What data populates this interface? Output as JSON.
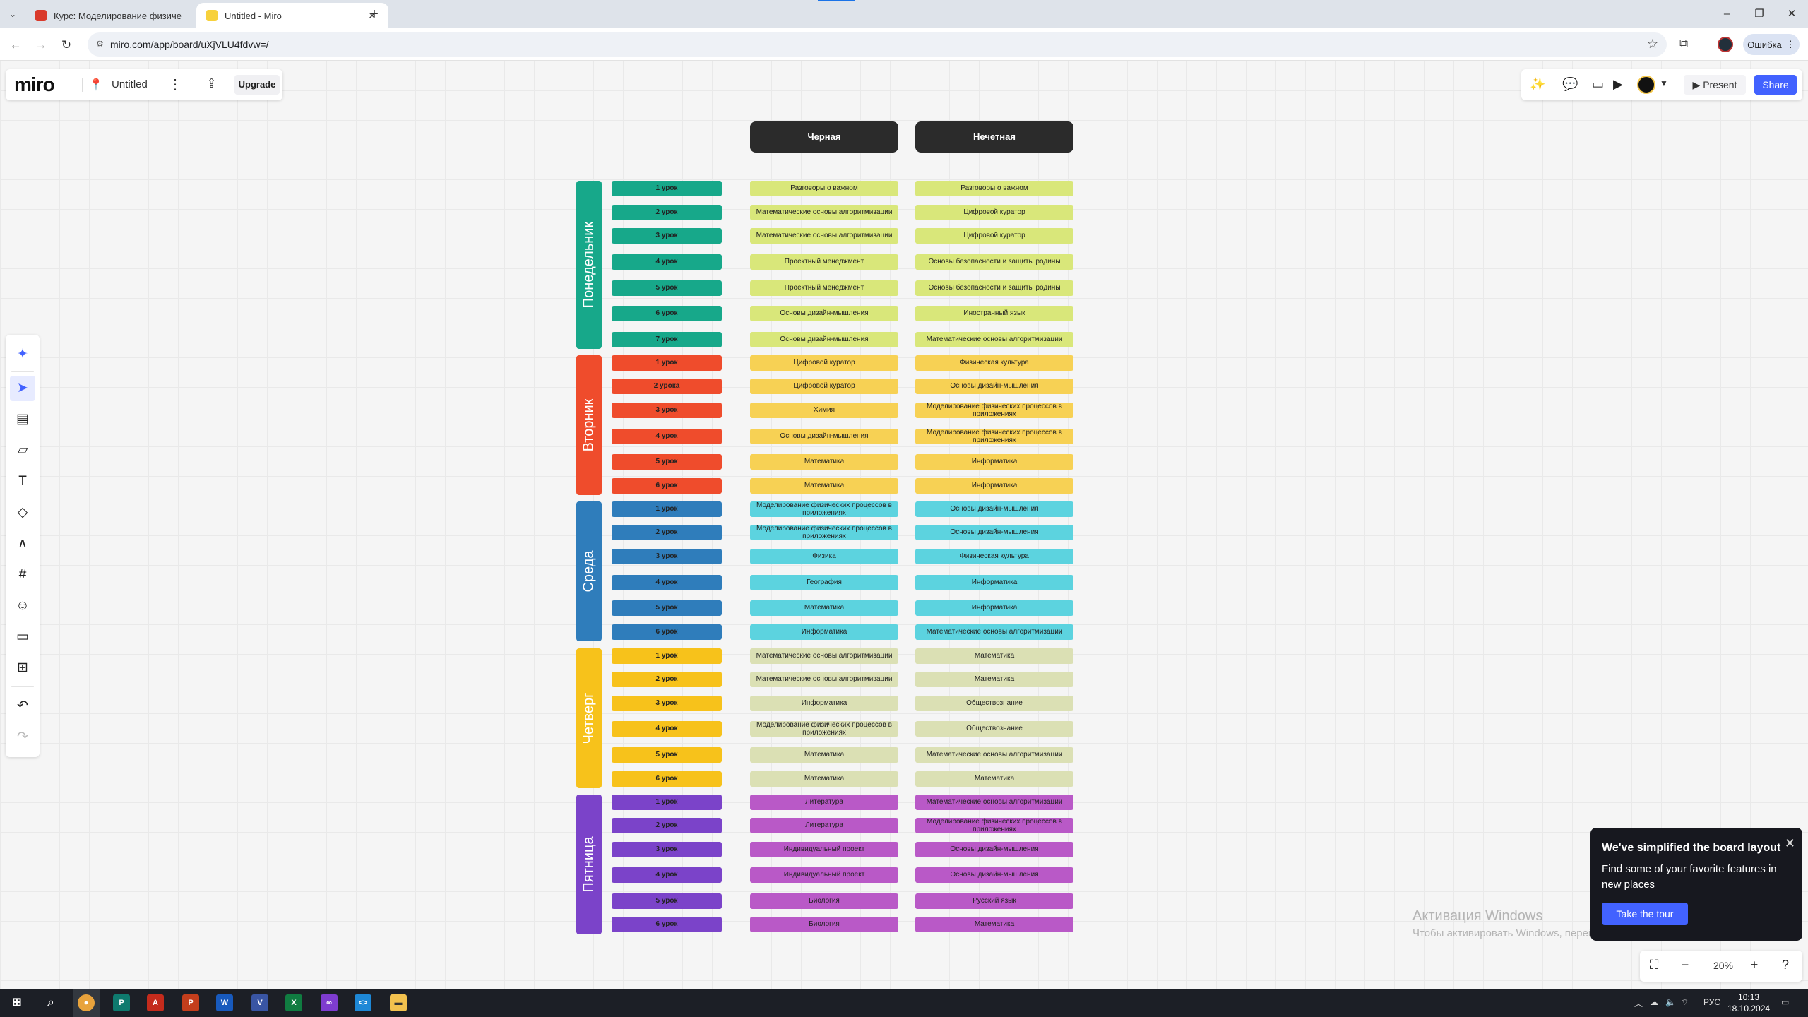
{
  "browser": {
    "tabs": [
      {
        "title": "Курс: Моделирование физиче",
        "active": false
      },
      {
        "title": "Untitled - Miro",
        "active": true
      }
    ],
    "url": "miro.com/app/board/uXjVLU4fdvw=/",
    "error_label": "Ошибка"
  },
  "miro": {
    "logo": "miro",
    "board_title": "Untitled",
    "upgrade_label": "Upgrade",
    "present_label": "Present",
    "share_label": "Share",
    "zoom": "20%",
    "accent_color": "#4262ff"
  },
  "schedule": {
    "headers": [
      "Черная",
      "Нечетная"
    ],
    "days": [
      {
        "name": "Понедельник",
        "color": "#17a88a",
        "lesson_color": "#17a88a",
        "cell_color": "#d9e77a",
        "lessons": [
          {
            "label": "1 урок",
            "a": "Разговоры о важном",
            "b": "Разговоры о важном"
          },
          {
            "label": "2 урок",
            "a": "Математические основы алгоритмизации",
            "b": "Цифровой куратор"
          },
          {
            "label": "3 урок",
            "a": "Математические основы алгоритмизации",
            "b": "Цифровой куратор"
          },
          {
            "label": "4 урок",
            "a": "Проектный менеджмент",
            "b": "Основы безопасности и защиты родины"
          },
          {
            "label": "5 урок",
            "a": "Проектный менеджмент",
            "b": "Основы безопасности и защиты родины"
          },
          {
            "label": "6 урок",
            "a": "Основы дизайн-мышления",
            "b": "Иностранный язык"
          },
          {
            "label": "7 урок",
            "a": "Основы дизайн-мышления",
            "b": "Математические основы алгоритмизации"
          }
        ]
      },
      {
        "name": "Вторник",
        "color": "#ef4c2c",
        "lesson_color": "#ef4c2c",
        "cell_color": "#f7d154",
        "lessons": [
          {
            "label": "1 урок",
            "a": "Цифровой куратор",
            "b": "Физическая культура"
          },
          {
            "label": "2 урока",
            "a": "Цифровой куратор",
            "b": "Основы дизайн-мышления"
          },
          {
            "label": "3 урок",
            "a": "Химия",
            "b": "Моделирование физических процессов в приложениях"
          },
          {
            "label": "4 урок",
            "a": "Основы дизайн-мышления",
            "b": "Моделирование физических процессов в приложениях"
          },
          {
            "label": "5 урок",
            "a": "Математика",
            "b": "Информатика"
          },
          {
            "label": "6 урок",
            "a": "Математика",
            "b": "Информатика"
          }
        ]
      },
      {
        "name": "Среда",
        "color": "#2f7dbb",
        "lesson_color": "#2f7dbb",
        "cell_color": "#5cd3df",
        "lessons": [
          {
            "label": "1 урок",
            "a": "Моделирование физических процессов в приложениях",
            "b": "Основы дизайн-мышления"
          },
          {
            "label": "2 урок",
            "a": "Моделирование физических процессов в приложениях",
            "b": "Основы дизайн-мышления"
          },
          {
            "label": "3 урок",
            "a": "Физика",
            "b": "Физическая культура"
          },
          {
            "label": "4 урок",
            "a": "География",
            "b": "Информатика"
          },
          {
            "label": "5 урок",
            "a": "Математика",
            "b": "Информатика"
          },
          {
            "label": "6 урок",
            "a": "Информатика",
            "b": "Математические основы алгоритмизации"
          }
        ]
      },
      {
        "name": "Четверг",
        "color": "#f7c21b",
        "lesson_color": "#f7c21b",
        "cell_color": "#dbe0b4",
        "lessons": [
          {
            "label": "1 урок",
            "a": "Математические основы алгоритмизации",
            "b": "Математика"
          },
          {
            "label": "2 урок",
            "a": "Математические основы алгоритмизации",
            "b": "Математика"
          },
          {
            "label": "3 урок",
            "a": "Информатика",
            "b": "Обществознание"
          },
          {
            "label": "4 урок",
            "a": "Моделирование физических процессов в приложениях",
            "b": "Обществознание"
          },
          {
            "label": "5 урок",
            "a": "Математика",
            "b": "Математические основы алгоритмизации"
          },
          {
            "label": "6 урок",
            "a": "Математика",
            "b": "Математика"
          }
        ]
      },
      {
        "name": "Пятница",
        "color": "#7b43c9",
        "lesson_color": "#7b43c9",
        "cell_color": "#b959c7",
        "lessons": [
          {
            "label": "1 урок",
            "a": "Литература",
            "b": "Математические основы алгоритмизации"
          },
          {
            "label": "2 урок",
            "a": "Литература",
            "b": "Моделирование физических процессов в приложениях"
          },
          {
            "label": "3 урок",
            "a": "Индивидуальный проект",
            "b": "Основы дизайн-мышления"
          },
          {
            "label": "4 урок",
            "a": "Индивидуальный проект",
            "b": "Основы дизайн-мышления"
          },
          {
            "label": "5 урок",
            "a": "Биология",
            "b": "Русский язык"
          },
          {
            "label": "6 урок",
            "a": "Биология",
            "b": "Математика"
          }
        ]
      }
    ]
  },
  "tour": {
    "title": "We've simplified the board layout",
    "body": "Find some of your favorite features in new places",
    "button": "Take the tour"
  },
  "watermark": {
    "line1": "Активация Windows",
    "line2": "Чтобы активировать Windows, перейдите в раздел \"Параметры\"."
  },
  "taskbar": {
    "lang": "РУС",
    "time": "10:13",
    "date": "18.10.2024"
  }
}
